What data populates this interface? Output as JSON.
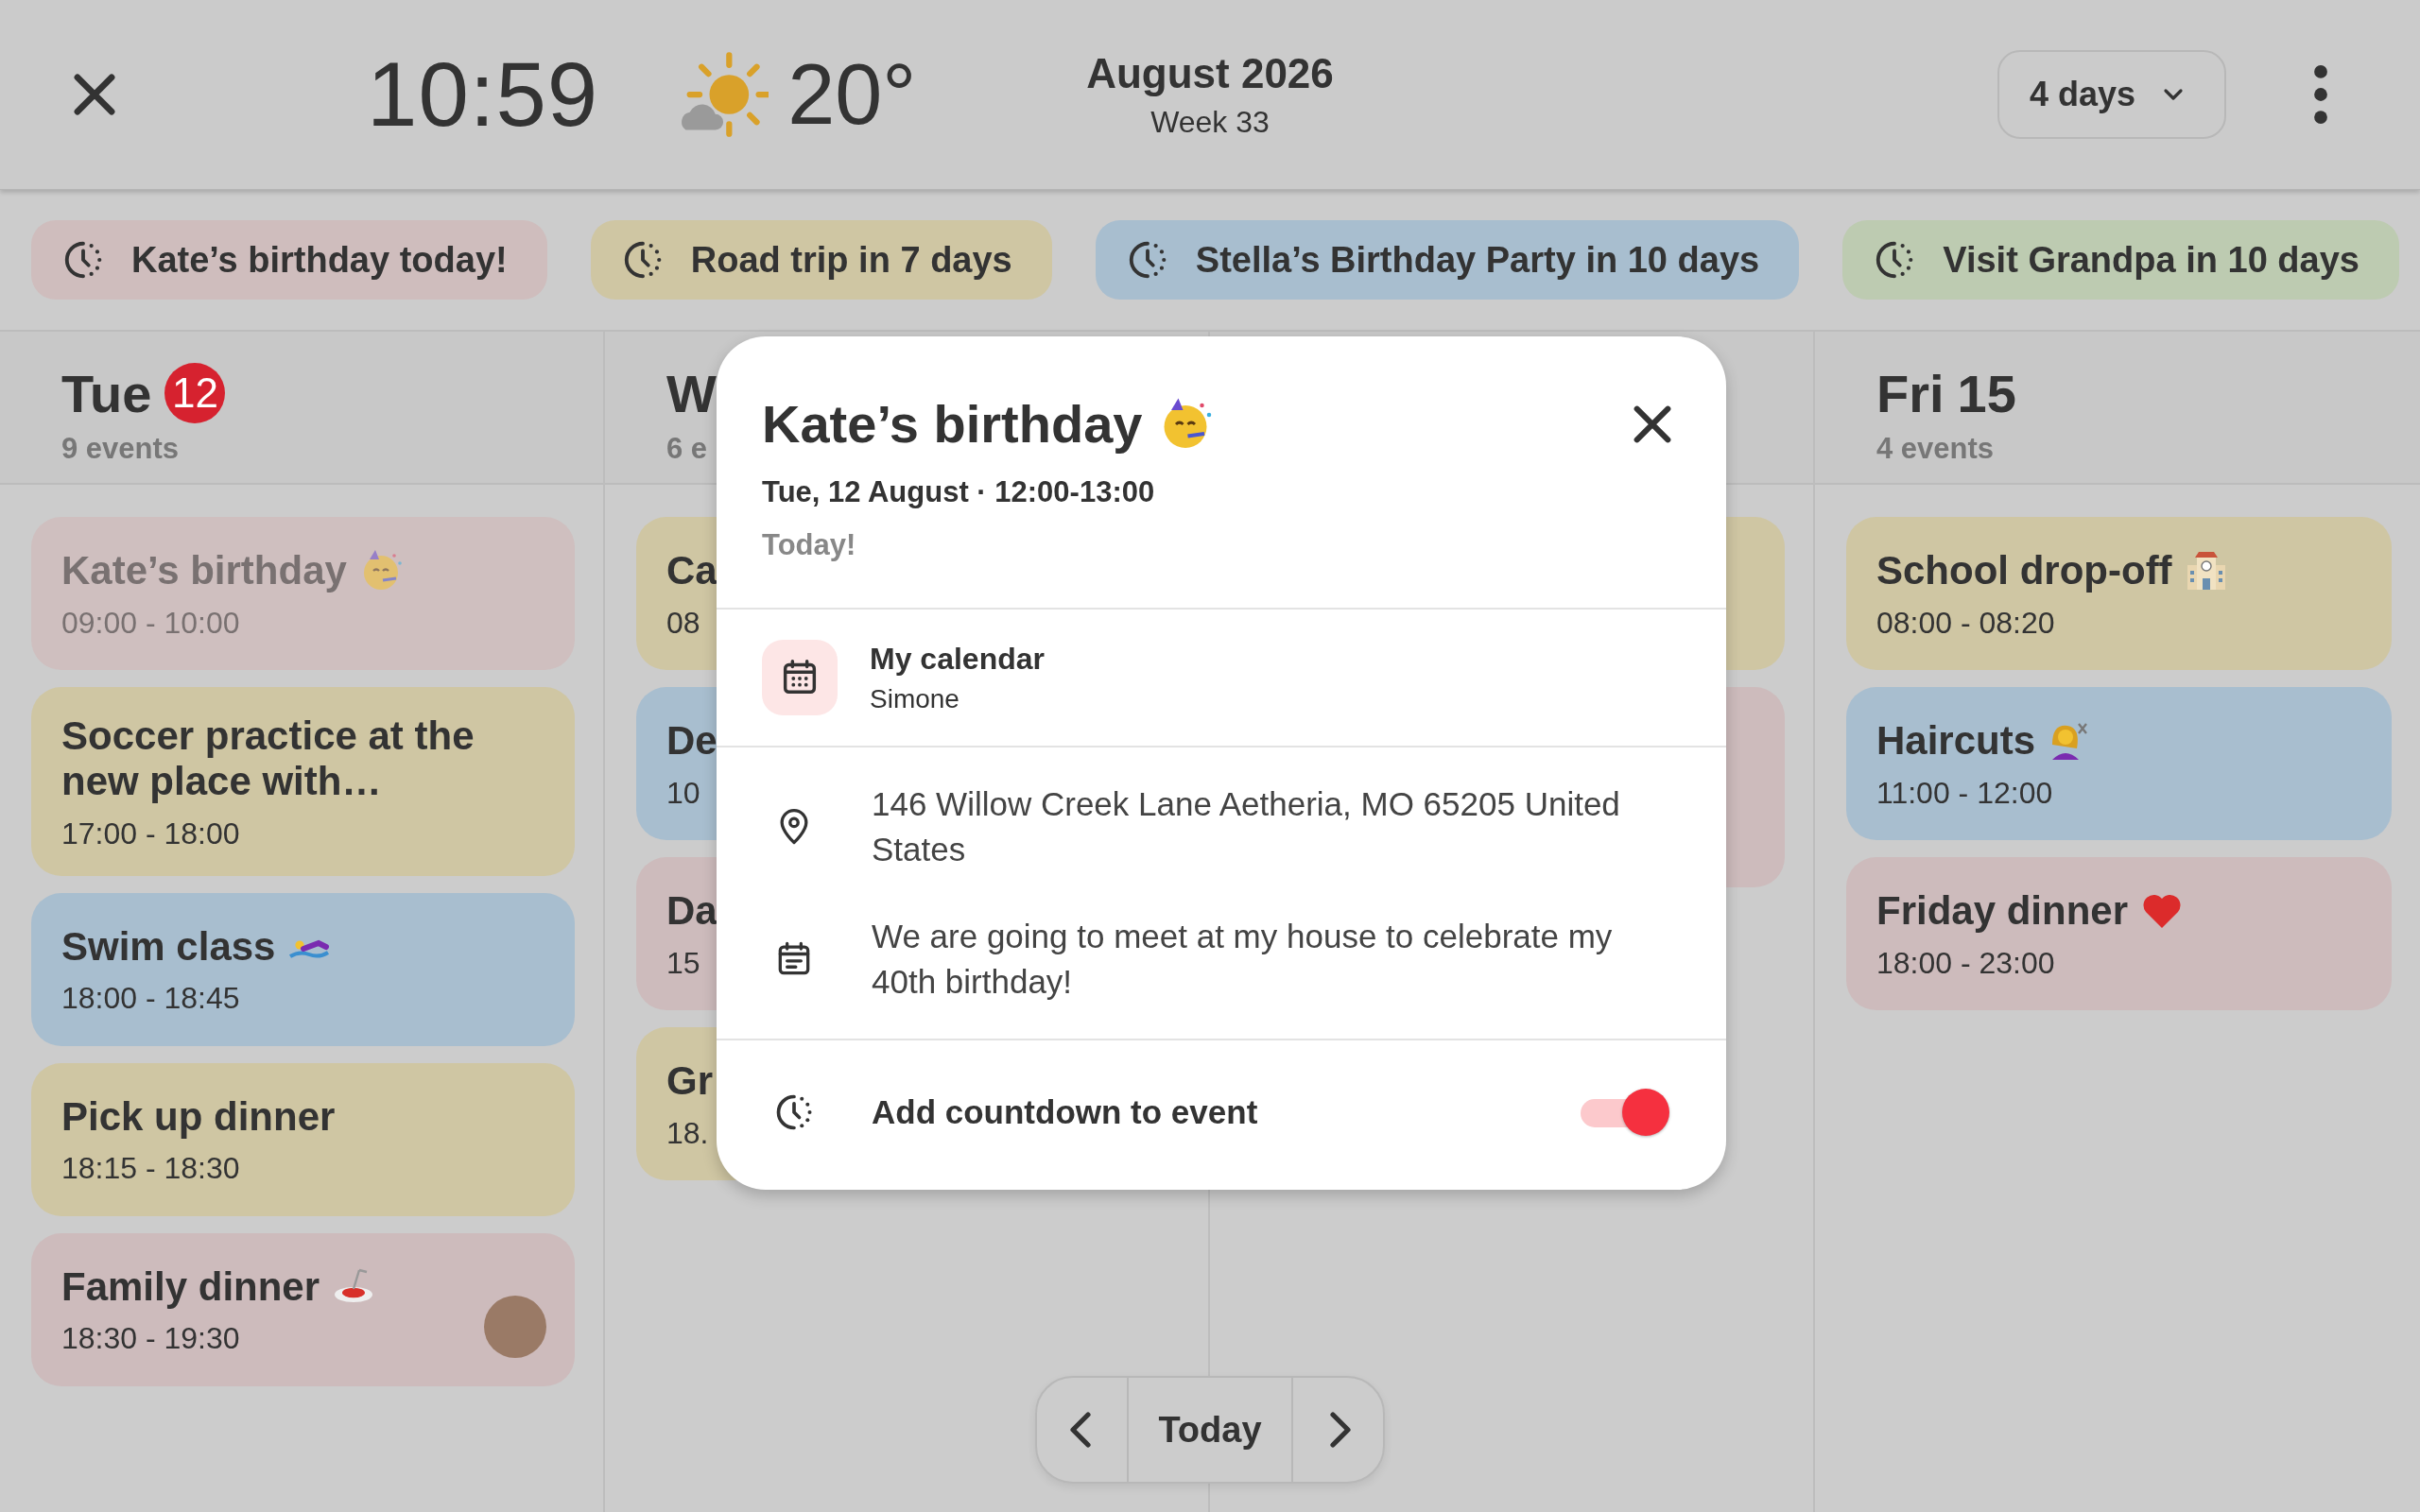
{
  "top_bar": {
    "time": "10:59",
    "temperature": "20°",
    "month": "August 2026",
    "week": "Week 33",
    "range_button": "4 days"
  },
  "countdowns": [
    {
      "label": "Kate’s birthday today!",
      "color": "#cfbdbd"
    },
    {
      "label": "Road trip in 7 days",
      "color": "#cfc6a3"
    },
    {
      "label": "Stella’s Birthday Party in 10 days",
      "color": "#a8becf"
    },
    {
      "label": "Visit Grandpa in 10 days",
      "color": "#bdcbb1"
    }
  ],
  "days": [
    {
      "day": "Tue",
      "date": "12",
      "today": true,
      "count": "9 events",
      "events": [
        {
          "title": "Kate’s birthday",
          "time": "09:00 - 10:00",
          "kind": "party",
          "color": "#cfbfbf",
          "past": true,
          "avatar": false
        },
        {
          "title": "Soccer practice at the new place with…",
          "time": "17:00 - 18:00",
          "kind": "plain",
          "color": "#cfc6a3",
          "past": false,
          "avatar": false
        },
        {
          "title": "Swim class",
          "time": "18:00 - 18:45",
          "kind": "swimmer",
          "color": "#a8becf",
          "past": false,
          "avatar": false
        },
        {
          "title": "Pick up dinner",
          "time": "18:15 - 18:30",
          "kind": "plain",
          "color": "#cfc6a3",
          "past": false,
          "avatar": false
        },
        {
          "title": "Family dinner",
          "time": "18:30 - 19:30",
          "kind": "spaghetti",
          "color": "#cdbbbc",
          "past": false,
          "avatar": true
        }
      ]
    },
    {
      "day": "W",
      "count": "6 e",
      "events": [
        {
          "title": "Ca",
          "time": "08",
          "color": "#cfc6a3"
        },
        {
          "title": "De",
          "time": "10",
          "color": "#a8becf"
        },
        {
          "title": "Da",
          "time": "15",
          "color": "#cdbbbc"
        },
        {
          "title": "Gr",
          "time": "18.",
          "color": "#cfc6a3"
        }
      ]
    },
    {
      "events": [
        {
          "color": "#cfc6a3"
        },
        {
          "color": "#cdbbbc",
          "tall": true
        }
      ]
    },
    {
      "day": "Fri",
      "date": "15",
      "today": false,
      "count": "4 events",
      "events": [
        {
          "title": "School drop-off",
          "time": "08:00 - 08:20",
          "kind": "school",
          "color": "#cfc6a3",
          "past": false,
          "avatar": false
        },
        {
          "title": "Haircuts",
          "time": "11:00 - 12:00",
          "kind": "haircut",
          "color": "#a8becf",
          "past": false,
          "avatar": false
        },
        {
          "title": "Friday dinner",
          "time": "18:00 - 23:00",
          "kind": "heart",
          "color": "#cdbbbc",
          "past": false,
          "avatar": false
        }
      ]
    }
  ],
  "event_dialog": {
    "title": "Kate’s birthday",
    "datetime": "Tue, 12 August · 12:00-13:00",
    "note": "Today!",
    "calendar": {
      "name": "My calendar",
      "owner": "Simone"
    },
    "location": "146 Willow Creek Lane Aetheria, MO 65205 United States",
    "description": "We are going to meet at my house to celebrate my 40th birthday!",
    "countdown": {
      "label": "Add countdown to event",
      "on": true
    }
  },
  "navigation": {
    "today_button": "Today"
  }
}
